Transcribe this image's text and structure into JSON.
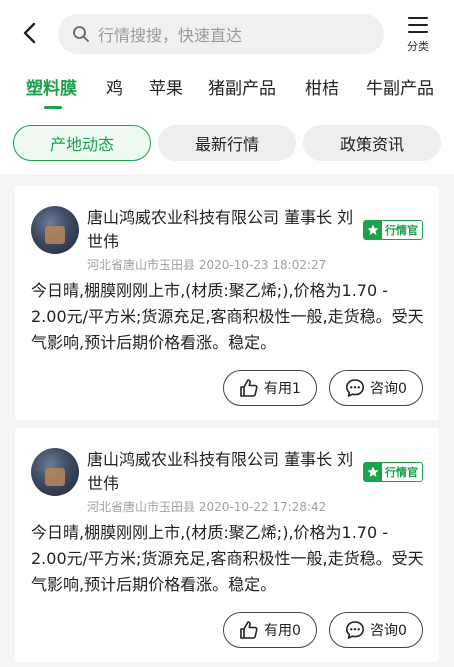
{
  "search": {
    "placeholder": "行情搜搜，快速直达"
  },
  "category": {
    "label": "分类"
  },
  "tabs": [
    {
      "label": "塑料膜",
      "active": true
    },
    {
      "label": "鸡"
    },
    {
      "label": "苹果"
    },
    {
      "label": "猪副产品"
    },
    {
      "label": "柑桔"
    },
    {
      "label": "牛副产品"
    }
  ],
  "subtabs": [
    {
      "label": "产地动态",
      "active": true
    },
    {
      "label": "最新行情"
    },
    {
      "label": "政策资讯"
    }
  ],
  "colors": {
    "accent": "#1aa34a"
  },
  "posts": [
    {
      "author": "唐山鸿威农业科技有限公司 董事长 刘世伟",
      "badge": "行情官",
      "location": "河北省唐山市玉田县",
      "time": "2020-10-23 18:02:27",
      "content": "今日晴,棚膜刚刚上市,(材质:聚乙烯;),价格为1.70 - 2.00元/平方米;货源充足,客商积极性一般,走货稳。受天气影响,预计后期价格看涨。稳定。",
      "useful": "有用1",
      "consult": "咨询0"
    },
    {
      "author": "唐山鸿威农业科技有限公司 董事长 刘世伟",
      "badge": "行情官",
      "location": "河北省唐山市玉田县",
      "time": "2020-10-22 17:28:42",
      "content": "今日晴,棚膜刚刚上市,(材质:聚乙烯;),价格为1.70 - 2.00元/平方米;货源充足,客商积极性一般,走货稳。受天气影响,预计后期价格看涨。稳定。",
      "useful": "有用0",
      "consult": "咨询0"
    }
  ]
}
